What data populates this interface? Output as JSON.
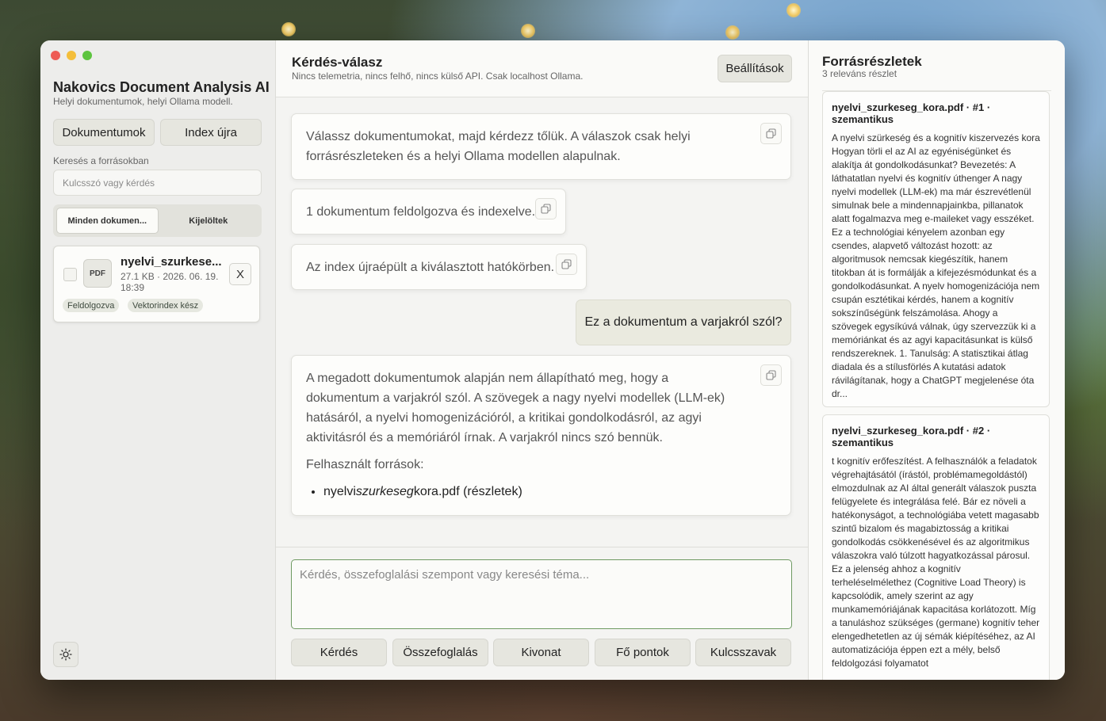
{
  "sidebar": {
    "app_title": "Nakovics Document Analysis AI",
    "app_subtitle": "Helyi dokumentumok, helyi Ollama modell.",
    "documents_button": "Dokumentumok",
    "reindex_button": "Index újra",
    "search_label": "Keresés a forrásokban",
    "search_placeholder": "Kulcsszó vagy kérdés",
    "segments": [
      "Minden dokumen...",
      "Kijelöltek"
    ],
    "document": {
      "type_label": "PDF",
      "name": "nyelvi_szurkese...",
      "meta": "27.1 KB · 2026. 06. 19. 18:39",
      "remove_label": "X",
      "tags": [
        "Feldolgozva",
        "Vektorindex kész"
      ]
    }
  },
  "main": {
    "title": "Kérdés-válasz",
    "subtitle": "Nincs telemetria, nincs felhő, nincs külső API. Csak localhost Ollama.",
    "settings_button": "Beállítások",
    "messages": [
      "Válassz dokumentumokat, majd kérdezz tőlük. A válaszok csak helyi forrásrészleteken és a helyi Ollama modellen alapulnak.",
      "1 dokumentum feldolgozva és indexelve.",
      "Az index újraépült a kiválasztott hatókörben."
    ],
    "user_message": "Ez a dokumentum a varjakról szól?",
    "answer": {
      "text": "A megadott dokumentumok alapján nem állapítható meg, hogy a dokumentum a varjakról szól. A szövegek a nagy nyelvi modellek (LLM-ek) hatásáról, a nyelvi homogenizációról, a kritikai gondolkodásról, az agyi aktivitásról és a memóriáról írnak. A varjakról nincs szó bennük.",
      "sources_label": "Felhasznált források:",
      "source_pre": "nyelvi",
      "source_italic": "szurkeseg",
      "source_post": "kora.pdf (részletek)"
    },
    "composer_placeholder": "Kérdés, összefoglalási szempont vagy keresési téma...",
    "actions": [
      "Kérdés",
      "Összefoglalás",
      "Kivonat",
      "Fő pontok",
      "Kulcsszavak"
    ]
  },
  "sources": {
    "title": "Forrásrészletek",
    "subtitle": "3 releváns részlet",
    "items": [
      {
        "title": "nyelvi_szurkeseg_kora.pdf · #1 · szemantikus",
        "text": "A nyelvi szürkeség és a kognitív kiszervezés kora Hogyan törli el az AI az egyéniségünket és alakítja át gondolkodásunkat? Bevezetés: A láthatatlan nyelvi és kognitív úthenger A nagy nyelvi modellek (LLM-ek) ma már észrevétlenül simulnak bele a mindennapjainkba, pillanatok alatt fogalmazva meg e-maileket vagy esszéket. Ez a technológiai kényelem azonban egy csendes, alapvető változást hozott: az algoritmusok nemcsak kiegészítik, hanem titokban át is formálják a kifejezésmódunkat és a gondolkodásunkat. A nyelv homogenizációja nem csupán esztétikai kérdés, hanem a kognitív sokszínűségünk felszámolása. Ahogy a szövegek egysíkúvá válnak, úgy szervezzük ki a memóriánkat és az agyi kapacitásunkat is külső rendszereknek. 1. Tanulság: A statisztikai átlag diadala és a stílusförlés A kutatási adatok rávilágítanak, hogy a ChatGPT megjelenése óta dr..."
      },
      {
        "title": "nyelvi_szurkeseg_kora.pdf · #2 · szemantikus",
        "text": "t kognitív erőfeszítést. A felhasználók a feladatok végrehajtásától (írástól, problémamegoldástól) elmozdulnak az AI által generált válaszok puszta felügyelete és integrálása felé. Bár ez növeli a hatékonyságot, a technológiába vetett magasabb szintű bizalom és magabiztosság a kritikai gondolkodás csökkenésével és az algoritmikus válaszokra való túlzott hagyatkozással párosul. Ez a jelenség ahhoz a kognitív terheléselmélethez (Cognitive Load Theory) is kapcsolódik, amely szerint az agy munkamemóriájának kapacitása korlátozott. Míg a tanuláshoz szükséges (germane) kognitív teher elengedhetetlen az új sémák kiépítéséhez, az AI automatizációja éppen ezt a mély, belső feldolgozási folyamatot"
      }
    ]
  }
}
